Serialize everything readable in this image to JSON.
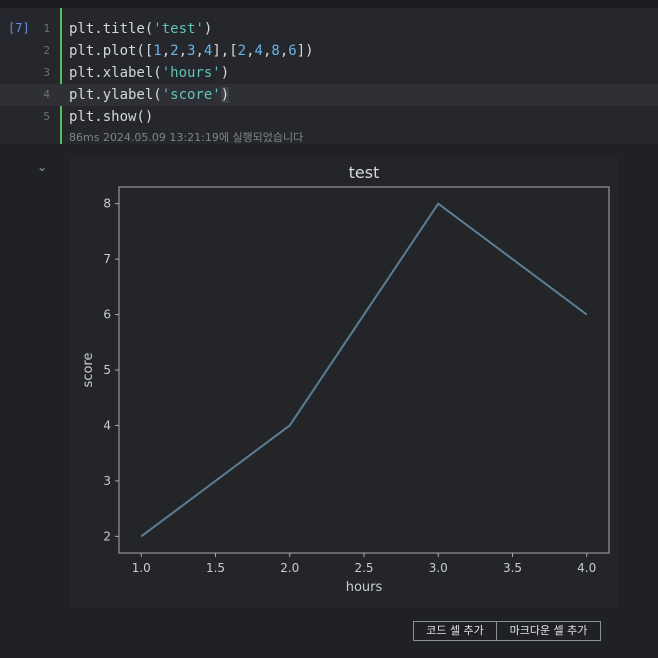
{
  "cell": {
    "execution_count": "[7]",
    "line_numbers": [
      "1",
      "2",
      "3",
      "4",
      "5"
    ],
    "status": "86ms 2024.05.09 13:21:19에 실행되었습니다"
  },
  "code": {
    "l1": {
      "a": "plt.title(",
      "b": "'test'",
      "c": ")"
    },
    "l2": {
      "a": "plt.plot([",
      "n1": "1",
      "n2": "2",
      "n3": "3",
      "n4": "4",
      "m1": "2",
      "m2": "4",
      "m3": "8",
      "m4": "6"
    },
    "l3": {
      "a": "plt.xlabel(",
      "b": "'hours'",
      "c": ")"
    },
    "l4": {
      "a": "plt.ylabel(",
      "b": "'score'",
      "c": ")"
    },
    "l5": {
      "a": "plt.show()"
    }
  },
  "colors": {
    "accent_bar": "#4cc15a",
    "series_line": "#5b7d95",
    "string": "#5fc4b2",
    "number": "#6ab4e8"
  },
  "icons": {
    "collapse": "chevron-down-icon"
  },
  "chart_data": {
    "type": "line",
    "title": "test",
    "xlabel": "hours",
    "ylabel": "score",
    "x": [
      1,
      2,
      3,
      4
    ],
    "series": [
      {
        "values": [
          2,
          4,
          8,
          6
        ]
      }
    ],
    "xlim": [
      0.85,
      4.15
    ],
    "ylim": [
      1.7,
      8.3
    ],
    "xticks": [
      "1.0",
      "1.5",
      "2.0",
      "2.5",
      "3.0",
      "3.5",
      "4.0"
    ],
    "yticks": [
      "2",
      "3",
      "4",
      "5",
      "6",
      "7",
      "8"
    ],
    "grid": false
  },
  "buttons": {
    "add_code_cell": "코드 셀 추가",
    "add_markdown_cell": "마크다운 셀 추가"
  }
}
